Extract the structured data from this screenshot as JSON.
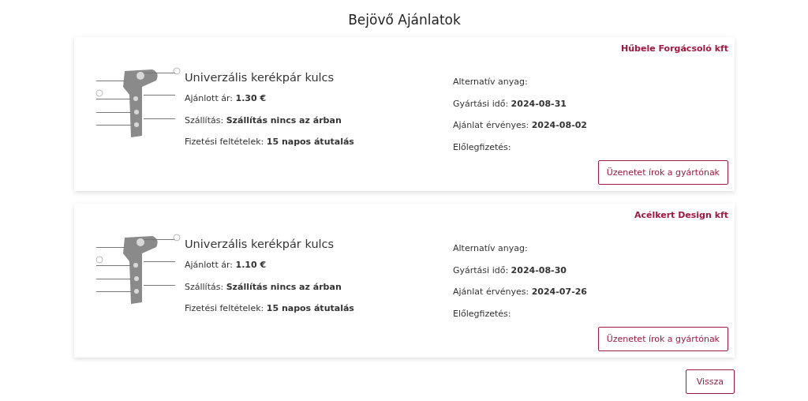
{
  "title": "Bejövő Ajánlatok",
  "offers": [
    {
      "company": "Hűbele Forgácsoló kft",
      "image": {
        "kind": "picture"
      },
      "product": "Univerzális kerékpár kulcs",
      "left": [
        "Ajánlott ár: **1.30 €**",
        "Szállítás: **Szállítás nincs az árban**",
        "Fizetési feltételek: **15 napos átutalás**"
      ],
      "right": [
        "Alternatív anyag:",
        "Gyártási idő: **2024-08-31**",
        "Ajánlat érvényes: **2024-08-02**",
        "Előlegfizetés:"
      ],
      "button": "Üzenetet írok a gyártónak"
    },
    {
      "company": "Acélkert Design kft",
      "image": {
        "kind": "picture"
      },
      "product": "Univerzális kerékpár kulcs",
      "left": [
        "Ajánlott ár: **1.10 €**",
        "Szállítás: **Szállítás nincs az árban**",
        "Fizetési feltételek: **15 napos átutalás**"
      ],
      "right": [
        "Alternatív anyag:",
        "Gyártási idő: **2024-08-30**",
        "Ajánlat érvényes: **2024-07-26**",
        "Előlegfizetés:"
      ],
      "button": "Üzenetet írok a gyártónak"
    }
  ],
  "back_button": "Vissza"
}
